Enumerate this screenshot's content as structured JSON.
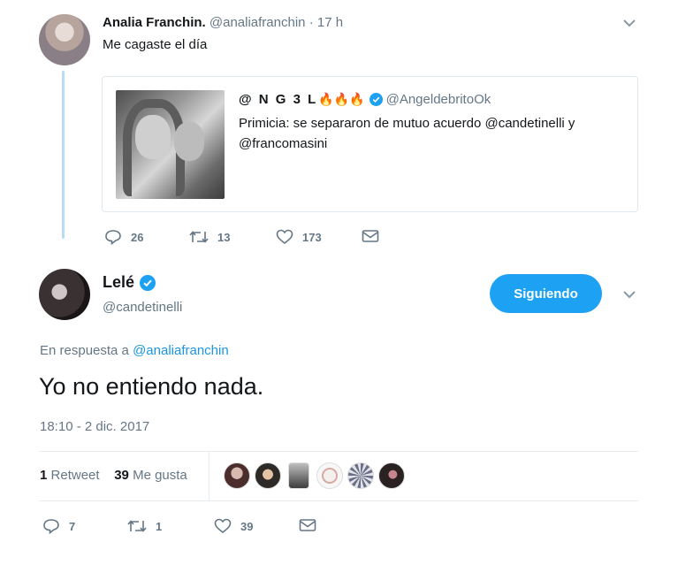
{
  "tweet1": {
    "name": "Analia Franchin.",
    "handle": "@analiafranchin",
    "time": "· 17 h",
    "text": "Me cagaste el día",
    "actions": {
      "replies": "26",
      "retweets": "13",
      "likes": "173"
    }
  },
  "quote": {
    "name": "@ N G 3 L",
    "name_emoji": "🔥🔥🔥",
    "handle": "@AngeldebritoOk",
    "text": "Primicia: se separaron de mutuo acuerdo @candetinelli y @francomasini"
  },
  "tweet2": {
    "name": "Lelé",
    "handle": "@candetinelli",
    "follow_label": "Siguiendo",
    "reply_prefix": "En respuesta a",
    "reply_handle": "@analiafranchin",
    "text": "Yo no entiendo nada.",
    "timestamp": "18:10 - 2 dic. 2017",
    "stats": {
      "retweets_count": "1",
      "retweets_label": "Retweet",
      "likes_count": "39",
      "likes_label": "Me gusta"
    },
    "actions": {
      "replies": "7",
      "retweets": "1",
      "likes": "39"
    }
  },
  "colors": {
    "accent": "#1da1f2",
    "link": "#1b95e0",
    "thread_line": "#b9dcf5",
    "muted": "#657786"
  }
}
